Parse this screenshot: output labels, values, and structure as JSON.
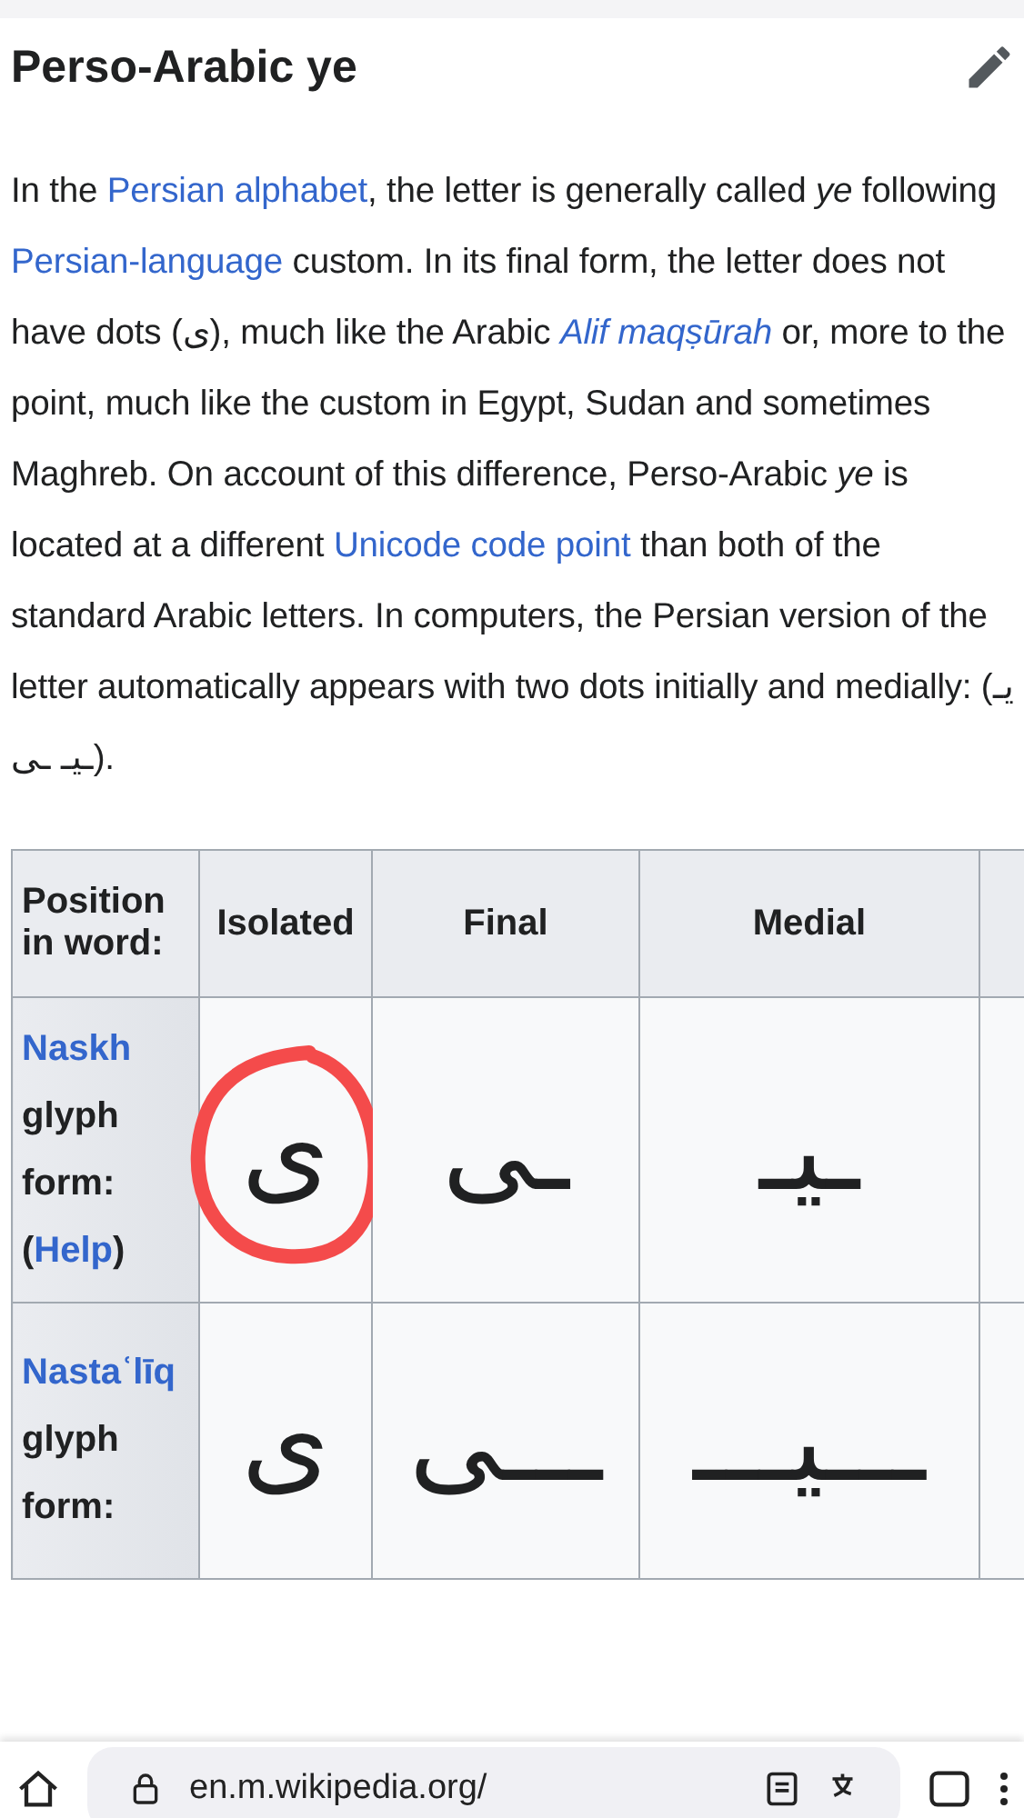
{
  "section": {
    "title": "Perso-Arabic ye"
  },
  "paragraph": [
    {
      "kind": "plain",
      "text": "In the "
    },
    {
      "kind": "link",
      "text": "Persian alphabet"
    },
    {
      "kind": "plain",
      "text": ", the letter is generally called "
    },
    {
      "kind": "italic",
      "text": "ye"
    },
    {
      "kind": "plain",
      "text": " following "
    },
    {
      "kind": "link",
      "text": "Persian-language"
    },
    {
      "kind": "plain",
      "text": " custom. In its final form, the letter does not have dots (ی), much like the Arabic "
    },
    {
      "kind": "italic-link",
      "text": "Alif maqṣūrah"
    },
    {
      "kind": "plain",
      "text": " or, more to the point, much like the custom in Egypt, Sudan and sometimes Maghreb. On account of this difference, Perso-Arabic "
    },
    {
      "kind": "italic",
      "text": "ye"
    },
    {
      "kind": "plain",
      "text": " is located at a different "
    },
    {
      "kind": "link",
      "text": "Unicode code point"
    },
    {
      "kind": "plain",
      "text": " than both of the standard Arabic letters. In computers, the Persian version of the letter automatically appears with two dots initially and medially: (یـ ـیـ ـی)."
    }
  ],
  "table": {
    "columns": [
      "Position in word:",
      "Isolated",
      "Final",
      "Medial"
    ],
    "rows": [
      {
        "cells": [
          {
            "kind": "header",
            "parts": [
              {
                "kind": "link",
                "text": "Naskh"
              },
              {
                "kind": "plain",
                "text": " glyph form: ("
              },
              {
                "kind": "link",
                "text": "Help"
              },
              {
                "kind": "plain",
                "text": ")"
              }
            ]
          },
          {
            "kind": "glyph",
            "text": "ی",
            "circled": true
          },
          {
            "kind": "glyph",
            "text": "ـی",
            "circled": false
          },
          {
            "kind": "glyph",
            "text": "ـیـ",
            "circled": false
          }
        ]
      },
      {
        "cells": [
          {
            "kind": "header",
            "parts": [
              {
                "kind": "link",
                "text": "Nastaʿlīq"
              },
              {
                "kind": "plain",
                "text": " glyph form:"
              }
            ]
          },
          {
            "kind": "glyph",
            "text": "ی",
            "circled": false
          },
          {
            "kind": "glyph",
            "text": "ـــی",
            "circled": false
          },
          {
            "kind": "glyph",
            "text": "ـــیـــ",
            "circled": false
          }
        ]
      }
    ]
  },
  "browser": {
    "url": "en.m.wikipedia.org/"
  }
}
